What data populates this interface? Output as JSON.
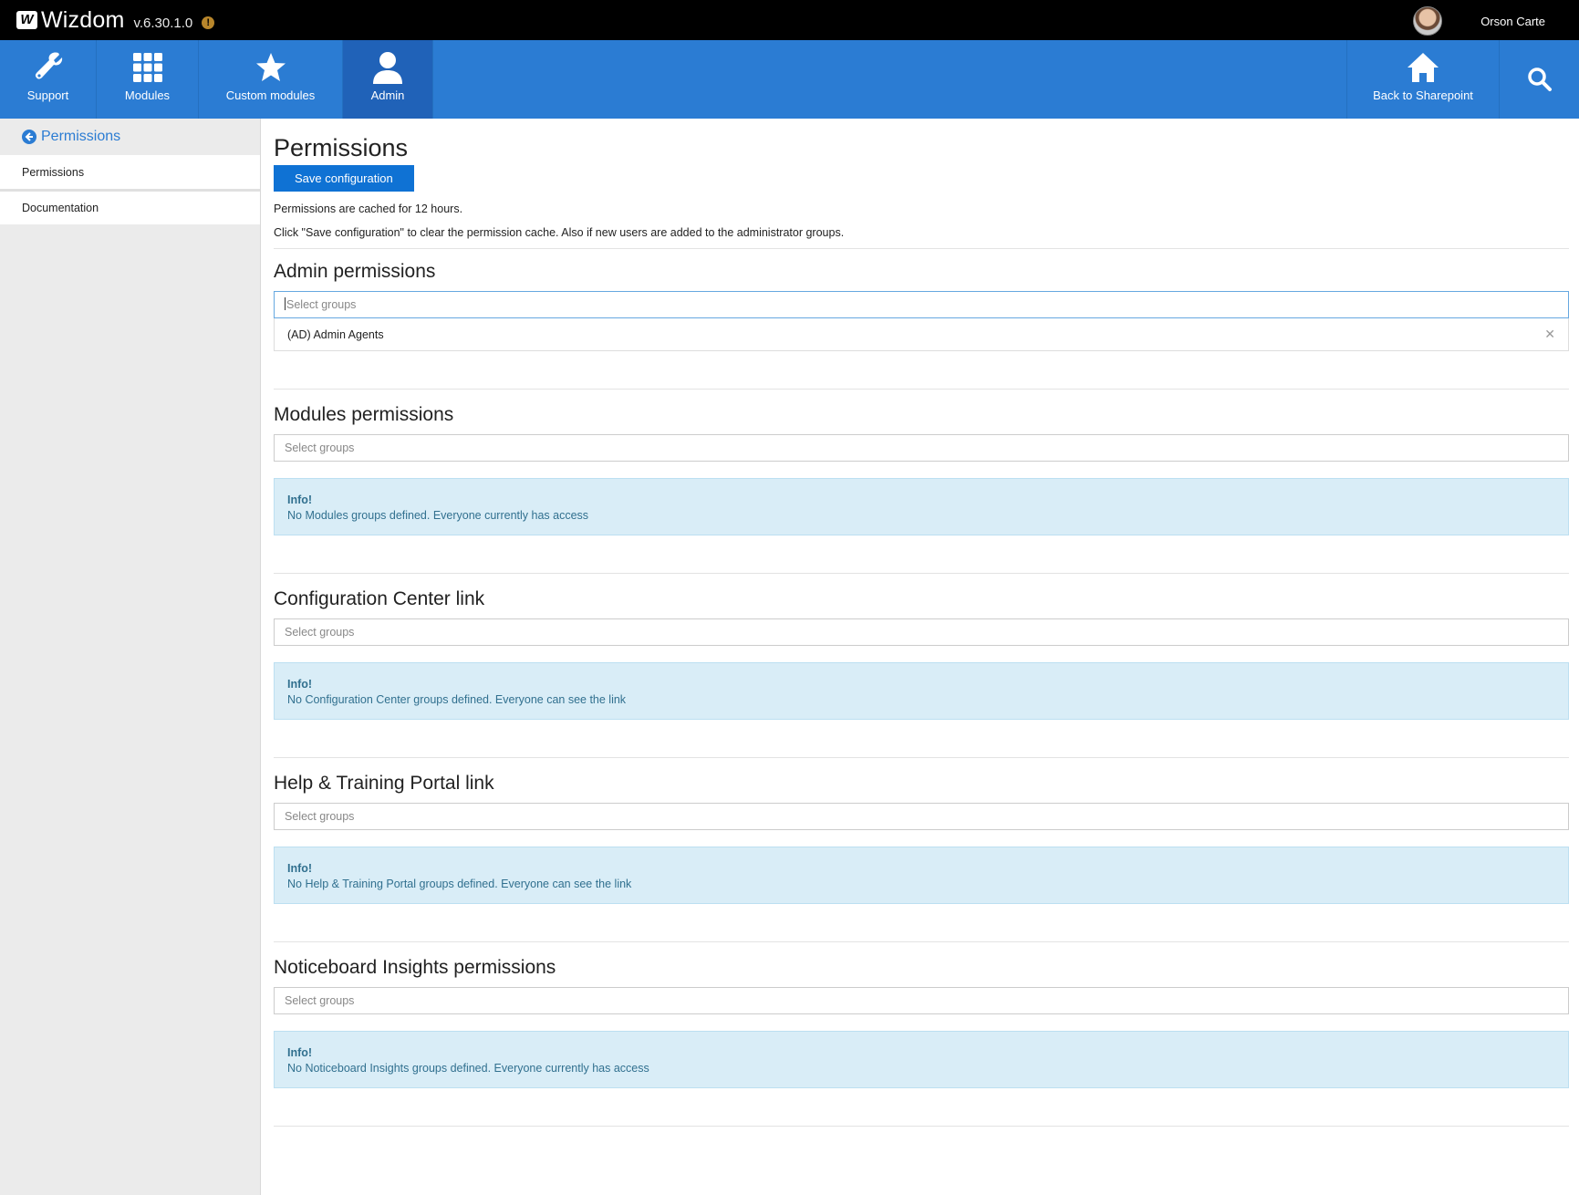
{
  "topbar": {
    "brand": "Wizdom",
    "version": "v.6.30.1.0",
    "user_name": "Orson Carte"
  },
  "nav": {
    "items": [
      {
        "label": "Support",
        "icon": "wrench-icon"
      },
      {
        "label": "Modules",
        "icon": "grid-icon"
      },
      {
        "label": "Custom modules",
        "icon": "star-icon"
      },
      {
        "label": "Admin",
        "icon": "user-icon",
        "active": true
      },
      {
        "label": "Back to Sharepoint",
        "icon": "home-icon"
      }
    ],
    "search_icon": "search-icon"
  },
  "sidebar": {
    "header": "Permissions",
    "items": [
      {
        "label": "Permissions"
      },
      {
        "label": "Documentation"
      }
    ]
  },
  "main": {
    "title": "Permissions",
    "save_label": "Save configuration",
    "note1": "Permissions are cached for 12 hours.",
    "note2": "Click \"Save configuration\" to clear the permission cache. Also if new users are added to the administrator groups.",
    "sections": [
      {
        "title": "Admin permissions",
        "placeholder": "Select groups",
        "selected": [
          "(AD) Admin Agents"
        ]
      },
      {
        "title": "Modules permissions",
        "placeholder": "Select groups",
        "info_title": "Info!",
        "info_text": "No Modules groups defined. Everyone currently has access"
      },
      {
        "title": "Configuration Center link",
        "placeholder": "Select groups",
        "info_title": "Info!",
        "info_text": "No Configuration Center groups defined. Everyone can see the link"
      },
      {
        "title": "Help & Training Portal link",
        "placeholder": "Select groups",
        "info_title": "Info!",
        "info_text": "No Help & Training Portal groups defined. Everyone can see the link"
      },
      {
        "title": "Noticeboard Insights permissions",
        "placeholder": "Select groups",
        "info_title": "Info!",
        "info_text": "No Noticeboard Insights groups defined. Everyone currently has access"
      }
    ]
  },
  "colors": {
    "nav_blue": "#2b7cd3",
    "nav_active": "#2062b8",
    "button_blue": "#0f72d4",
    "info_bg": "#d9edf7",
    "info_text": "#31708f"
  }
}
